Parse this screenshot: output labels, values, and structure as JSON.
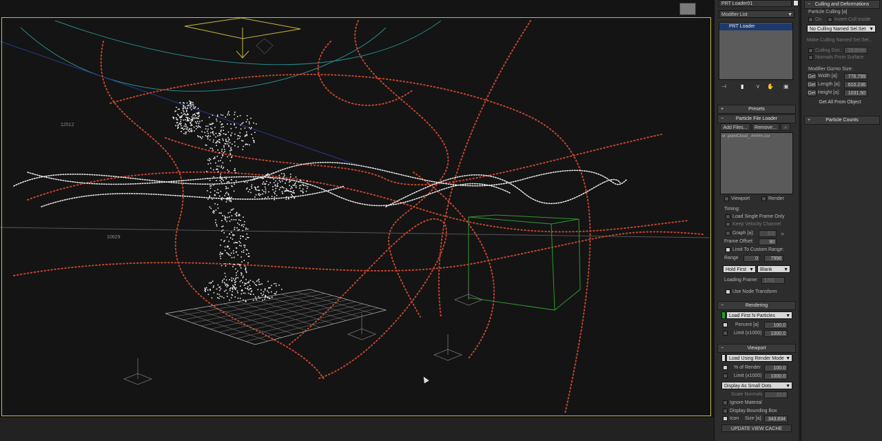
{
  "viewport": {
    "labels": [
      "12512",
      "10629"
    ],
    "stroke_colors": {
      "spline_red": "#c4452e",
      "spline_white": "#e8e8e8",
      "frame": "#c9b84a",
      "cube": "#2f9a2f",
      "camera": "#c8b83a",
      "teal": "#2a8a8a"
    }
  },
  "command_panel": {
    "object_name": "PRT Loader01",
    "modifier_list": "Modifier List",
    "stack_item": "PRT Loader",
    "presets_header": "Presets",
    "file_loader_header": "Particle File Loader",
    "add_files": "Add Files...",
    "remove": "Remove...",
    "file_entry": "vr :pointCloud_ #####.csv",
    "viewport_chk": "Viewport",
    "render_chk": "Render",
    "timing_label": "Timing:",
    "load_single_frame": "Load Single Frame Only",
    "keep_velocity": "Keep Velocity Channel",
    "graph_label": "Graph [a]:",
    "graph_value": "0.0",
    "frame_offset_label": "Frame Offset:",
    "frame_offset_value": "90",
    "limit_custom_range": "Limit To Custom Range:",
    "range_label": "Range",
    "range_start": "0",
    "range_end": "7998",
    "hold_first": "Hold First",
    "blank": "Blank",
    "loading_frame_label": "Loading Frame:",
    "loading_frame_value": "1701",
    "use_node_transform": "Use Node Transform",
    "rendering_header": "Rendering",
    "load_first_n": "Load First N Particles",
    "percent_label": "Percent [a]",
    "percent_value": "100.0",
    "limit_label": "Limit (x1000)",
    "limit_value": "1000.0",
    "viewport_header": "Viewport",
    "load_using_render": "Load Using Render Mode",
    "pct_render_label": "% of Render",
    "pct_render_value": "100.0",
    "vlimit_label": "Limit (x1000)",
    "vlimit_value": "1000.0",
    "display_mode": "Display As Small Dots",
    "scale_normals_label": "Scale Normals",
    "scale_normals_value": "10.0",
    "ignore_material": "Ignore Material",
    "display_bbox": "Display Bounding Box",
    "icon_label": "Icon",
    "size_label": "Size [a]:",
    "size_value": "343.834",
    "update_cache": "UPDATE VIEW CACHE"
  },
  "culling_panel": {
    "header": "Culling and Deformations",
    "particle_culling_label": "Particle Culling [a]",
    "on_label": "On",
    "invert_cull": "Invert-Cull Inside",
    "no_culling": "No Culling Named Sel.Set",
    "make_culling": "Make Culling Named Sel.Set...",
    "culling_dist_label": "Culling Dist.:",
    "culling_dist_value": "10.0mm",
    "normals_from_surface": "Normals From Surface",
    "gizmo_size_label": "Modifier Gizmo Size:",
    "get": "Get",
    "width_label": "Width [a]:",
    "width_value": "776.799",
    "length_label": "Length [a]:",
    "length_value": "610.236",
    "height_label": "Height [a]:",
    "height_value": "1031.50",
    "get_all": "Get All From Object",
    "particle_counts_header": "Particle Counts"
  }
}
